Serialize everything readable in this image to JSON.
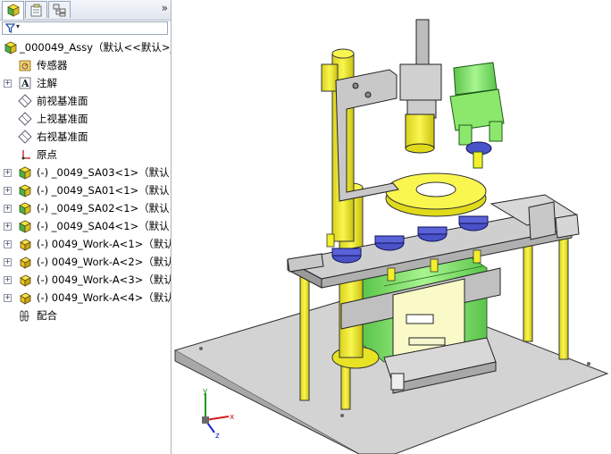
{
  "panel": {
    "tabs": [
      "featuremanager-tab",
      "propertymanager-tab",
      "configurationmanager-tab"
    ],
    "collapse_label": "»",
    "filter_label": "▾"
  },
  "tree": [
    {
      "label": "_000049_Assy（默认<<默认>_",
      "icon": "assembly-icon",
      "indent": 0,
      "expander": ""
    },
    {
      "label": "传感器",
      "icon": "sensor-folder-icon",
      "indent": 1,
      "expander": ""
    },
    {
      "label": "注解",
      "icon": "annotation-icon",
      "indent": 1,
      "expander": "+"
    },
    {
      "label": "前视基准面",
      "icon": "plane-icon",
      "indent": 1,
      "expander": ""
    },
    {
      "label": "上视基准面",
      "icon": "plane-icon",
      "indent": 1,
      "expander": ""
    },
    {
      "label": "右视基准面",
      "icon": "plane-icon",
      "indent": 1,
      "expander": ""
    },
    {
      "label": "原点",
      "icon": "origin-icon",
      "indent": 1,
      "expander": ""
    },
    {
      "label": "(-) _0049_SA03<1>（默认<",
      "icon": "subassembly-icon",
      "indent": 1,
      "expander": "+"
    },
    {
      "label": "(-) _0049_SA01<1>（默认<",
      "icon": "subassembly-icon",
      "indent": 1,
      "expander": "+"
    },
    {
      "label": "(-) _0049_SA02<1>（默认<",
      "icon": "subassembly-icon",
      "indent": 1,
      "expander": "+"
    },
    {
      "label": "(-) _0049_SA04<1>（默认<",
      "icon": "subassembly-icon",
      "indent": 1,
      "expander": "+"
    },
    {
      "label": "(-) 0049_Work-A<1>（默认",
      "icon": "part-icon",
      "indent": 1,
      "expander": "+"
    },
    {
      "label": "(-) 0049_Work-A<2>（默认",
      "icon": "part-icon",
      "indent": 1,
      "expander": "+"
    },
    {
      "label": "(-) 0049_Work-A<3>（默认",
      "icon": "part-icon",
      "indent": 1,
      "expander": "+"
    },
    {
      "label": "(-) 0049_Work-A<4>（默认",
      "icon": "part-icon",
      "indent": 1,
      "expander": "+"
    },
    {
      "label": "配合",
      "icon": "mates-icon",
      "indent": 1,
      "expander": ""
    }
  ],
  "triad": {
    "x_label": "x",
    "y_label": "y",
    "z_label": "z"
  },
  "colors": {
    "yellow": "#f4ef2a",
    "green": "#8ce86c",
    "gray": "#c8c8c8",
    "blue": "#4a52c8",
    "plate": "#d4d4d4"
  }
}
